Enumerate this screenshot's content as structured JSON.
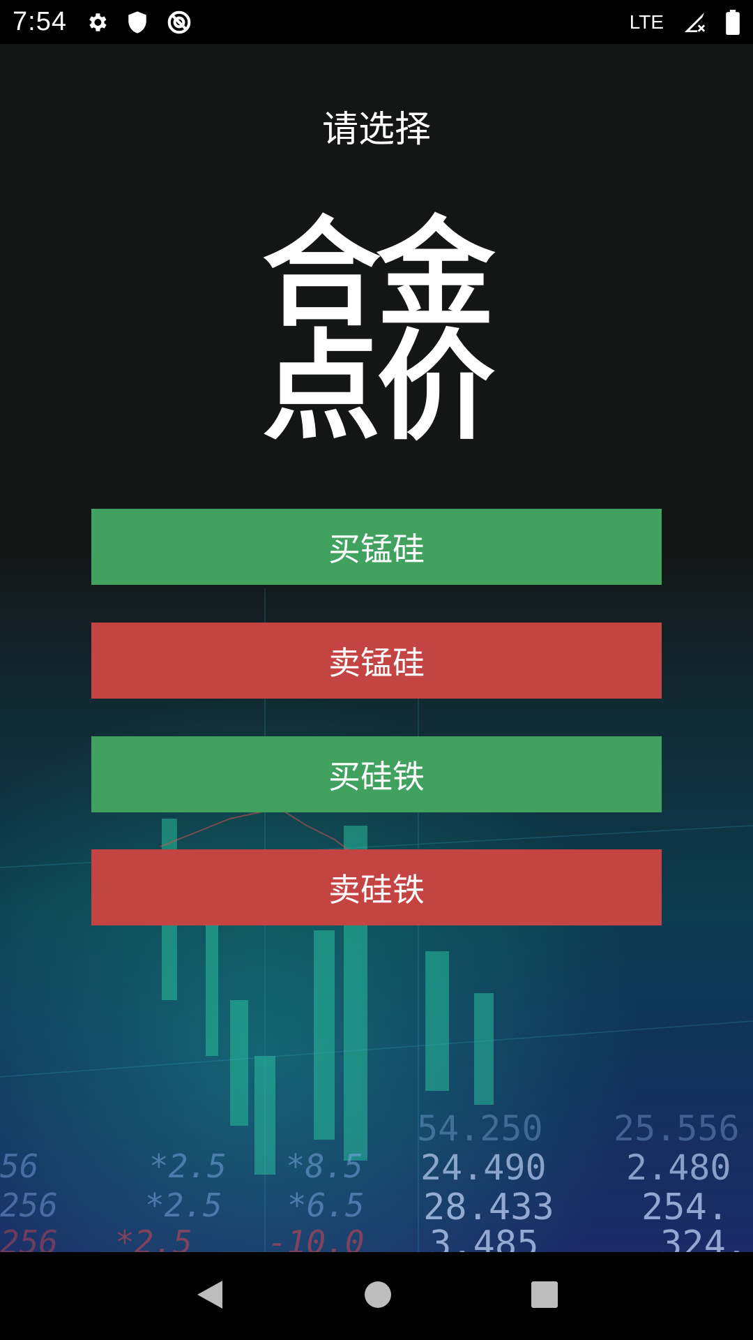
{
  "status_bar": {
    "time": "7:54",
    "icons_left": [
      "gear-icon",
      "shield-icon",
      "data-saver-icon"
    ],
    "network": "LTE",
    "icons_right": [
      "signal-icon",
      "battery-icon"
    ]
  },
  "app": {
    "title": "请选择",
    "logo_line1": "合金",
    "logo_line2": "点价",
    "buttons": [
      {
        "label": "买锰硅",
        "color": "#41a260"
      },
      {
        "label": "卖锰硅",
        "color": "#c44443"
      },
      {
        "label": "买硅铁",
        "color": "#41a260"
      },
      {
        "label": "卖硅铁",
        "color": "#c44443"
      }
    ]
  },
  "background_numbers": [
    "54.250",
    "25.556",
    "24.490",
    "2.480",
    "28.433",
    "254.",
    "3.485",
    "324.",
    "*2.5",
    "*8.5",
    "*2.5",
    "*6.5",
    "*2.5",
    "-10.0",
    "56",
    "256",
    "256"
  ],
  "nav_bar": {
    "icons": [
      "back-icon",
      "home-icon",
      "recents-icon"
    ]
  }
}
